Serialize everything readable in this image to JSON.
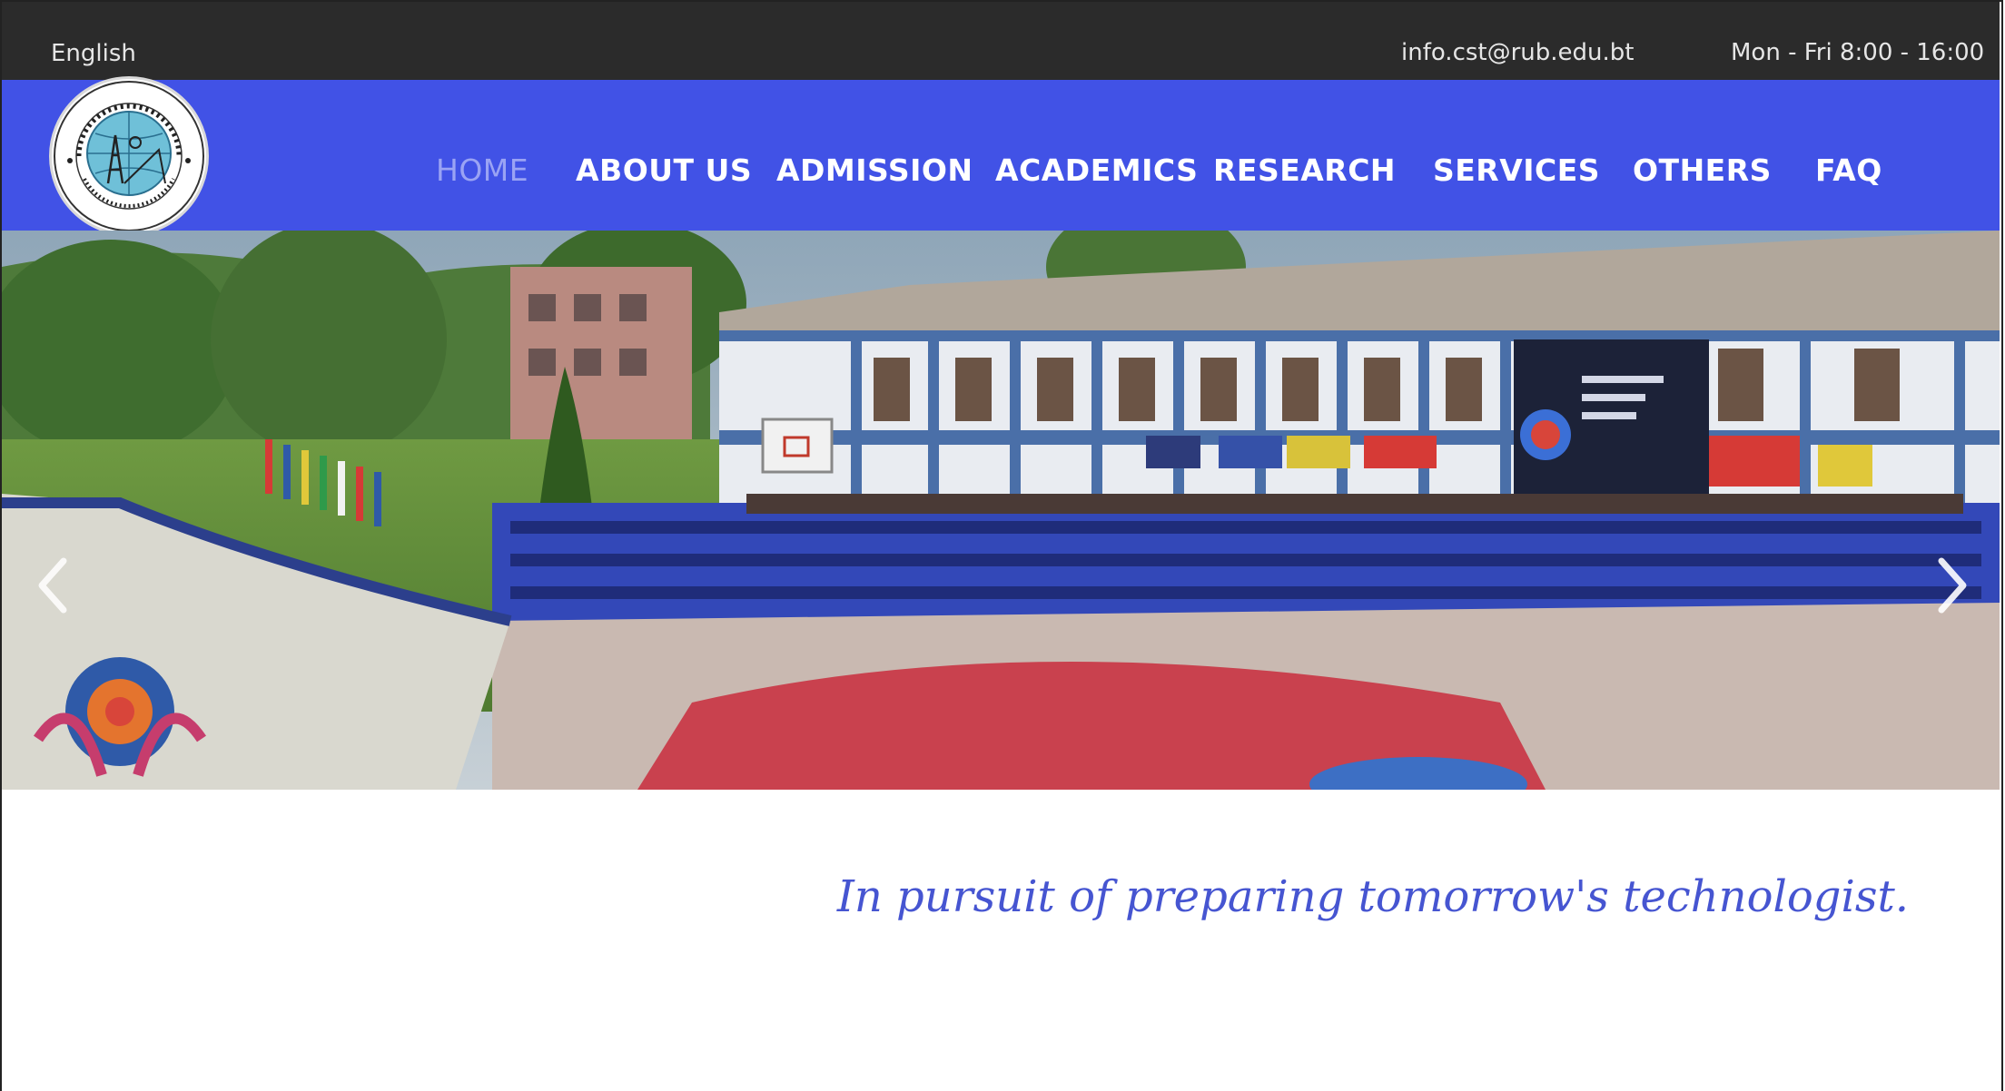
{
  "topbar": {
    "language": "English",
    "email": "info.cst@rub.edu.bt",
    "hours": "Mon - Fri 8:00 - 16:00"
  },
  "logo": {
    "name": "College of Science and Technology"
  },
  "nav": {
    "items": [
      {
        "label": "HOME",
        "active": true
      },
      {
        "label": "ABOUT US"
      },
      {
        "label": "ADMISSION"
      },
      {
        "label": "ACADEMICS"
      },
      {
        "label": "RESEARCH"
      },
      {
        "label": "SERVICES"
      },
      {
        "label": "OTHERS"
      },
      {
        "label": "FAQ"
      }
    ]
  },
  "hero": {
    "prev_icon": "chevron-left-icon",
    "next_icon": "chevron-right-icon"
  },
  "tagline": "In pursuit of preparing tomorrow's technologist.",
  "colors": {
    "topbar_bg": "#2b2b2b",
    "nav_bg": "#4152e6",
    "nav_active": "#9aa3f4",
    "tagline": "#4655d1"
  }
}
